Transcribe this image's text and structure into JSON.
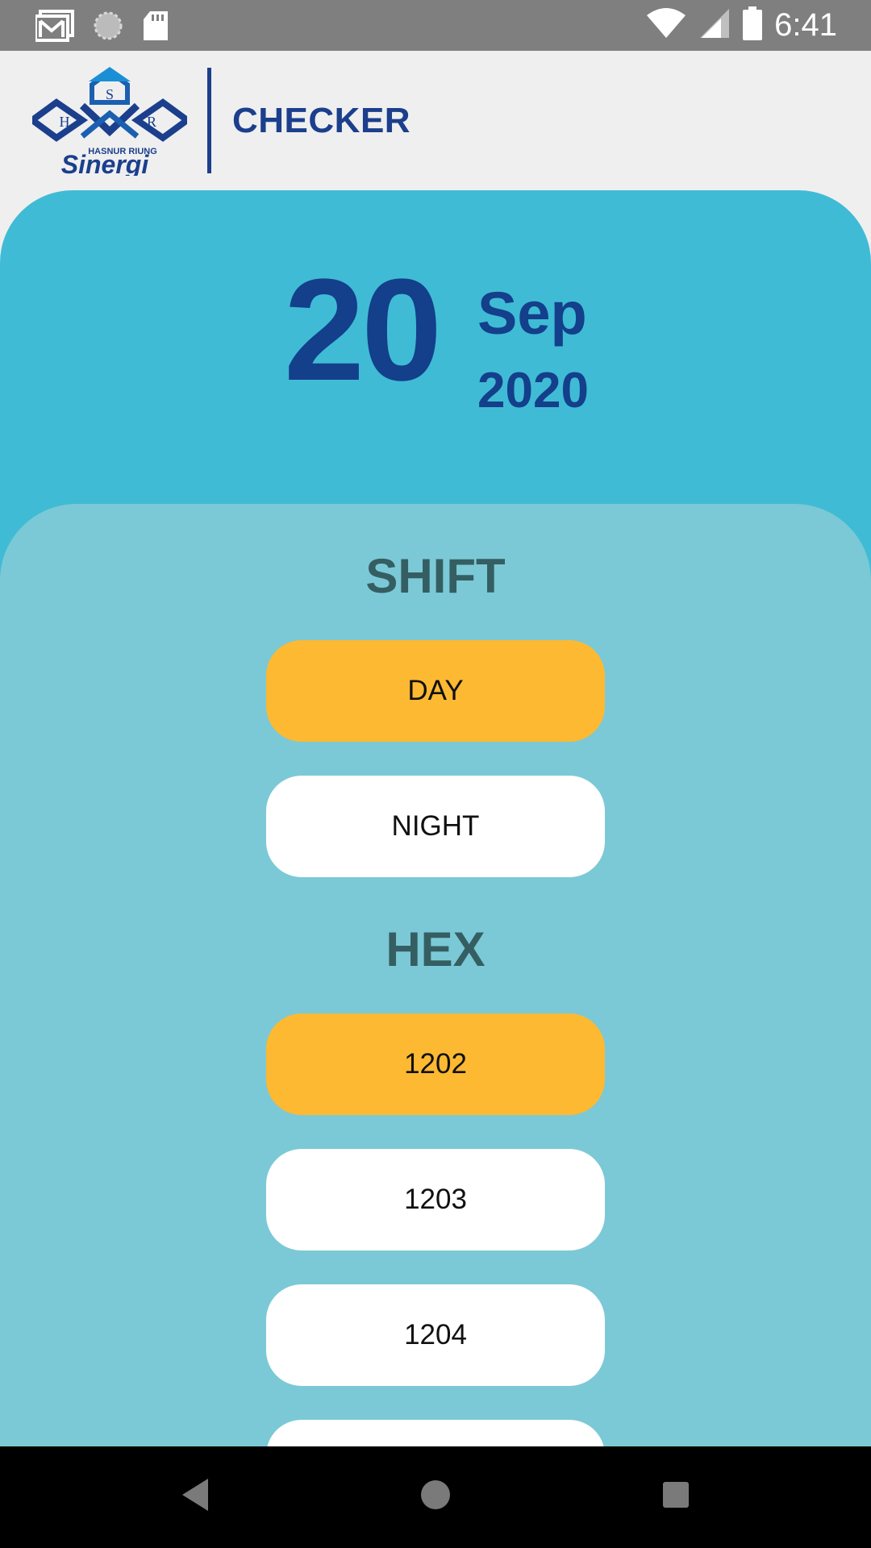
{
  "status_bar": {
    "time": "6:41",
    "icons": [
      "gmail-icon",
      "sync-icon",
      "sd-card-icon",
      "wifi-icon",
      "signal-icon",
      "battery-icon"
    ]
  },
  "header": {
    "brand_small": "HASNUR RIUNG",
    "brand_name": "Sinergi",
    "logo_letters": [
      "S",
      "H",
      "R"
    ],
    "title": "CHECKER"
  },
  "date": {
    "day": "20",
    "month": "Sep",
    "year": "2020"
  },
  "shift": {
    "title": "SHIFT",
    "options": [
      {
        "label": "DAY",
        "selected": true
      },
      {
        "label": "NIGHT",
        "selected": false
      }
    ]
  },
  "hex": {
    "title": "HEX",
    "options": [
      {
        "label": "1202",
        "selected": true
      },
      {
        "label": "1203",
        "selected": false
      },
      {
        "label": "1204",
        "selected": false
      },
      {
        "label": "",
        "selected": false
      }
    ]
  },
  "navigation": [
    "back-icon",
    "home-icon",
    "recents-icon"
  ],
  "colors": {
    "brand_blue": "#133f8b",
    "panel_blue": "#40bbd5",
    "options_panel": "#7bc9d6",
    "selected": "#fdb932",
    "section_title": "#355e63"
  }
}
